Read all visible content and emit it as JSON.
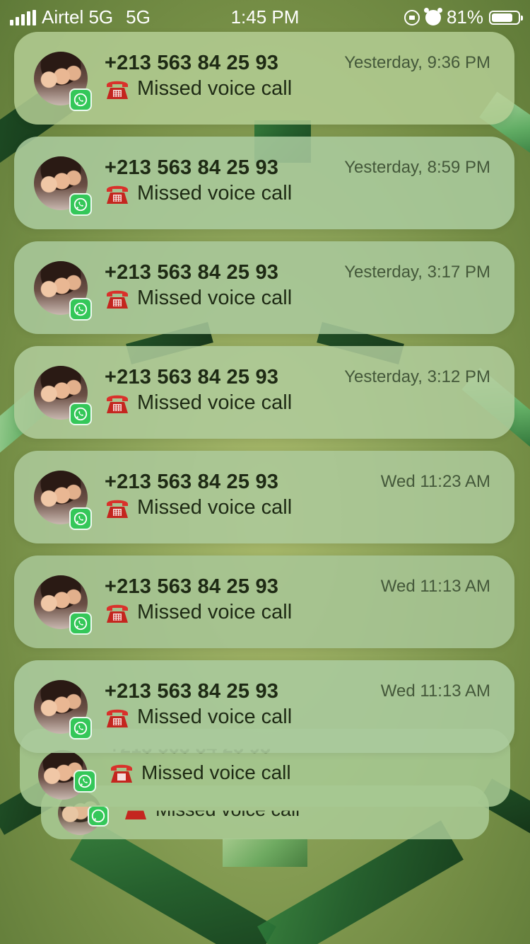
{
  "status_bar": {
    "carrier": "Airtel 5G",
    "network": "5G",
    "time": "1:45 PM",
    "battery_percent": "81%",
    "battery_level": 0.81,
    "icons": [
      "orientation-lock-icon",
      "alarm-icon",
      "battery-icon",
      "signal-icon"
    ]
  },
  "notifications": [
    {
      "title": "+213 563 84 25 93",
      "body": "Missed voice call",
      "time": "Yesterday, 9:36 PM",
      "app": "WhatsApp"
    },
    {
      "title": "+213 563 84 25 93",
      "body": "Missed voice call",
      "time": "Yesterday, 8:59 PM",
      "app": "WhatsApp"
    },
    {
      "title": "+213 563 84 25 93",
      "body": "Missed voice call",
      "time": "Yesterday, 3:17 PM",
      "app": "WhatsApp"
    },
    {
      "title": "+213 563 84 25 93",
      "body": "Missed voice call",
      "time": "Yesterday, 3:12 PM",
      "app": "WhatsApp"
    },
    {
      "title": "+213 563 84 25 93",
      "body": "Missed voice call",
      "time": "Wed 11:23 AM",
      "app": "WhatsApp"
    },
    {
      "title": "+213 563 84 25 93",
      "body": "Missed voice call",
      "time": "Wed 11:13 AM",
      "app": "WhatsApp"
    },
    {
      "title": "+213 563 84 25 93",
      "body": "Missed voice call",
      "time": "Wed 11:13 AM",
      "app": "WhatsApp"
    }
  ],
  "stacked_notifications": [
    {
      "title": "+213 563 84 25 93",
      "body": "Missed voice call"
    },
    {
      "body": "Missed voice call"
    }
  ],
  "colors": {
    "whatsapp_green": "#34c759",
    "phone_red": "#d9312b"
  }
}
